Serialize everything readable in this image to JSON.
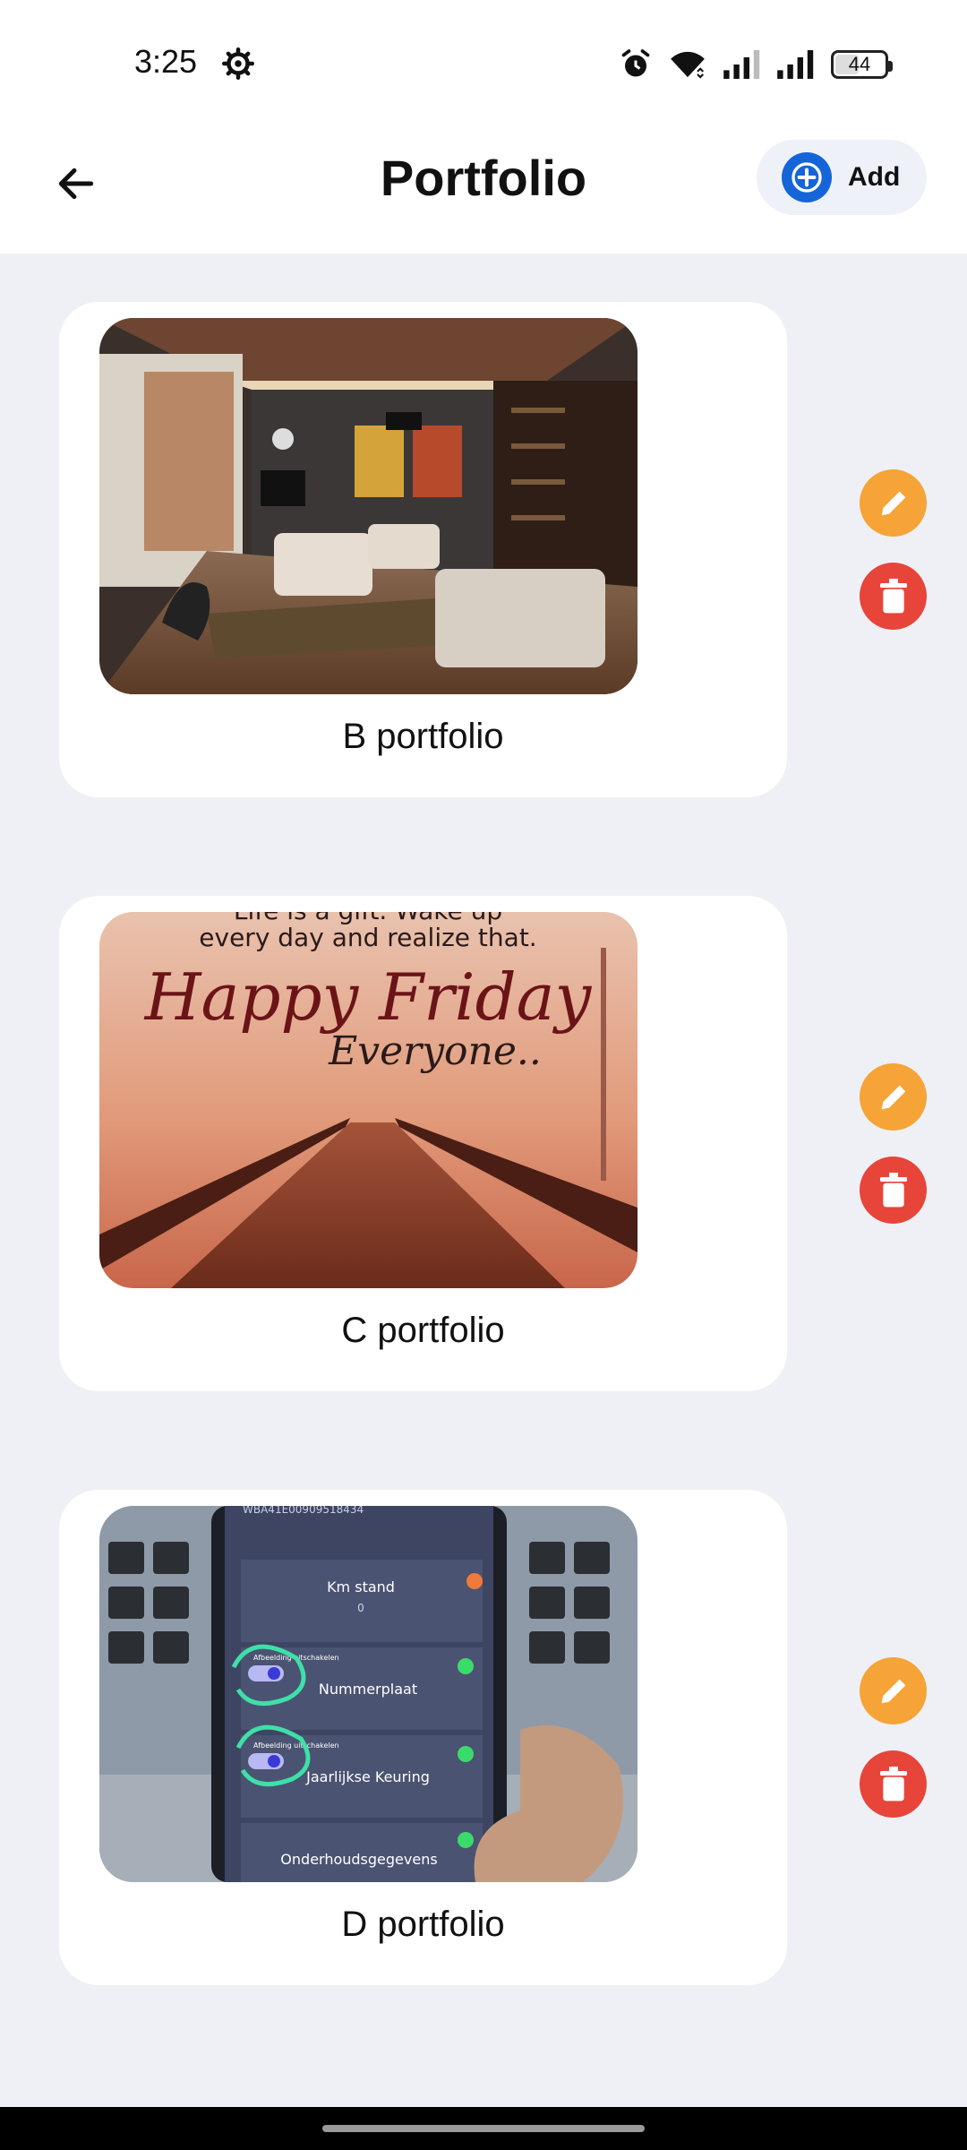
{
  "status_bar": {
    "time": "3:25",
    "battery": "44",
    "icons": [
      "settings-icon",
      "alarm-icon",
      "wifi-icon",
      "signal-icon",
      "signal-icon",
      "battery-icon"
    ]
  },
  "app_bar": {
    "title": "Portfolio",
    "back_icon": "arrow-left-icon",
    "add_label": "Add",
    "add_icon": "plus-circle-icon"
  },
  "portfolio_items": [
    {
      "label": "B portfolio",
      "image": "living room interior photo"
    },
    {
      "label": "C portfolio",
      "image": "pier at sunset photo",
      "image_text": {
        "line1": "Life is a gift. Wake up",
        "line2": "every day and realize that.",
        "line3": "Happy Friday",
        "line4": "Everyone.."
      }
    },
    {
      "label": "D portfolio",
      "image": "phone screen on laptop photo",
      "image_text": {
        "vin": "WBA41E00909518434",
        "km": "Km stand",
        "km_value": "0",
        "toggle_label": "Afbeelding uitschakelen",
        "row1": "Nummerplaat",
        "row2": "Jaarlijkse Keuring",
        "row3": "Onderhoudsgegevens"
      }
    }
  ],
  "colors": {
    "background": "#eef0f5",
    "card": "#ffffff",
    "edit": "#f6a437",
    "delete": "#e7453a",
    "accent": "#1665d8"
  }
}
